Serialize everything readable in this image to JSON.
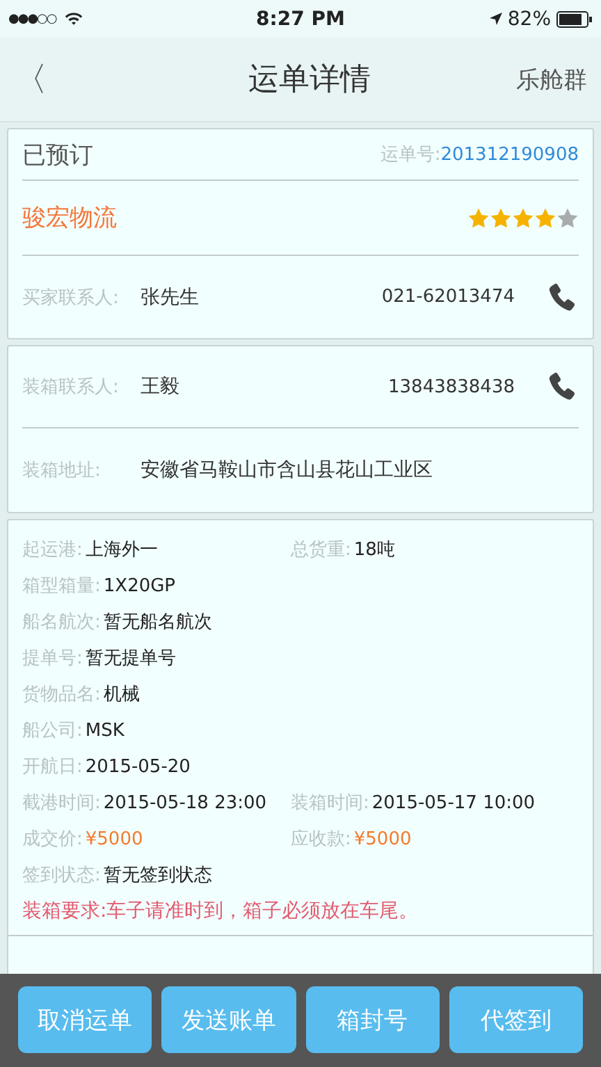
{
  "status_bar": {
    "signal": "●●●○○",
    "time": "8:27 PM",
    "battery": "82%"
  },
  "nav": {
    "back": "〈",
    "title": "运单详情",
    "action": "乐舱群"
  },
  "order": {
    "status": "已预订",
    "number_label": "运单号:",
    "number": "201312190908",
    "company": "骏宏物流",
    "stars": 4
  },
  "buyer_contact": {
    "label": "买家联系人:",
    "name": "张先生",
    "phone": "021-62013474"
  },
  "loading": {
    "contact_label": "装箱联系人:",
    "contact_name": "王毅",
    "phone": "13843838438",
    "address_label": "装箱地址:",
    "address": "安徽省马鞍山市含山县花山工业区"
  },
  "details": [
    {
      "cells": [
        {
          "label": "起运港:",
          "value": "上海外一",
          "kind": "plain"
        },
        {
          "label": "总货重:",
          "value": "18吨",
          "kind": "plain"
        }
      ]
    },
    {
      "cells": [
        {
          "label": "箱型箱量:",
          "value": "1X20GP",
          "kind": "plain"
        }
      ]
    },
    {
      "cells": [
        {
          "label": "船名航次:",
          "value": "暂无船名航次",
          "kind": "plain"
        }
      ]
    },
    {
      "cells": [
        {
          "label": "提单号:",
          "value": "暂无提单号",
          "kind": "plain"
        }
      ]
    },
    {
      "cells": [
        {
          "label": "货物品名:",
          "value": "机械",
          "kind": "plain"
        }
      ]
    },
    {
      "cells": [
        {
          "label": "船公司:",
          "value": "MSK",
          "kind": "plain"
        }
      ]
    },
    {
      "cells": [
        {
          "label": "开航日:",
          "value": "2015-05-20",
          "kind": "plain"
        }
      ]
    },
    {
      "cells": [
        {
          "label": "截港时间:",
          "value": "2015-05-18 23:00",
          "kind": "plain"
        },
        {
          "label": "装箱时间:",
          "value": "2015-05-17 10:00",
          "kind": "plain"
        }
      ]
    },
    {
      "cells": [
        {
          "label": "成交价:",
          "value": "¥5000",
          "kind": "price"
        },
        {
          "label": "应收款:",
          "value": "¥5000",
          "kind": "price"
        }
      ]
    },
    {
      "cells": [
        {
          "label": "签到状态:",
          "value": "暂无签到状态",
          "kind": "plain"
        }
      ]
    }
  ],
  "requirement": "装箱要求:车子请准时到，箱子必须放在车尾。",
  "buttons": [
    "取消运单",
    "发送账单",
    "箱封号",
    "代签到"
  ]
}
